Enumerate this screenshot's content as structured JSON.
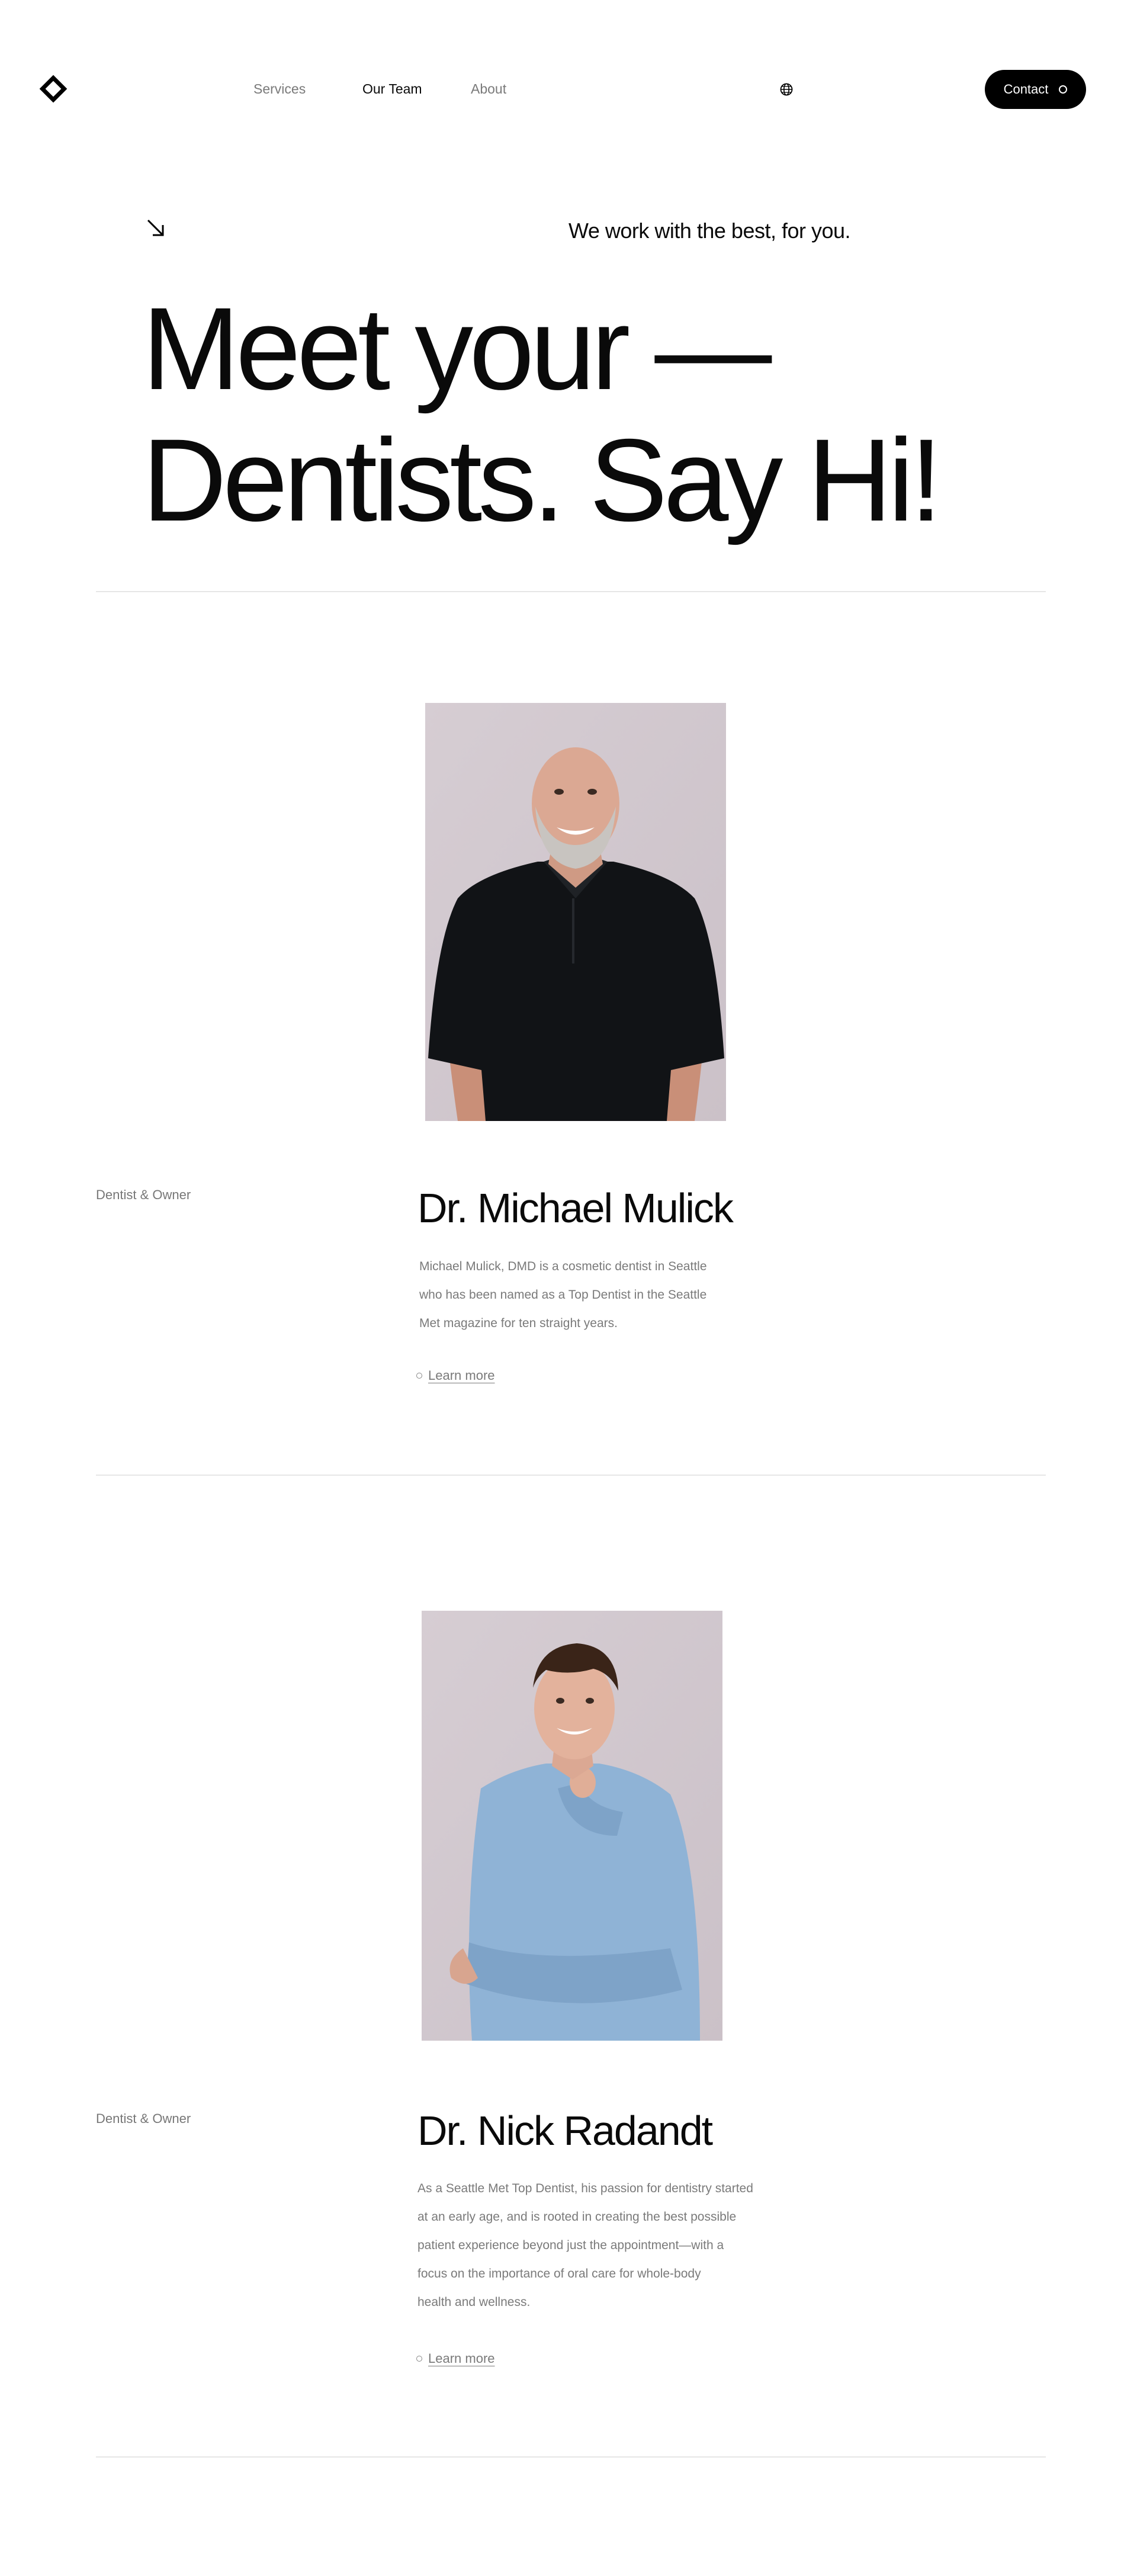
{
  "nav": {
    "links": [
      {
        "label": "Services"
      },
      {
        "label": "Our Team"
      },
      {
        "label": "About"
      }
    ],
    "contact_label": "Contact"
  },
  "hero": {
    "tagline": "We work with the best, for you.",
    "headline_line1": "Meet your —",
    "headline_line2": "Dentists. Say Hi!"
  },
  "dentists": [
    {
      "role": "Dentist & Owner",
      "name": "Dr. Michael Mulick",
      "bio_lines": [
        "Michael Mulick, DMD is a cosmetic dentist in Seattle",
        "who has been named as a Top Dentist in the Seattle",
        "Met magazine for ten straight years."
      ],
      "cta": "Learn more",
      "shirt_color": "#111316"
    },
    {
      "role": "Dentist & Owner",
      "name": "Dr. Nick Radandt",
      "bio_lines": [
        "As a Seattle Met Top Dentist, his passion for dentistry started",
        "at an early age, and is rooted in creating the best possible",
        "patient experience beyond just the appointment—with a",
        "focus on the importance of oral care for whole-body",
        "health and wellness."
      ],
      "cta": "Learn more",
      "shirt_color": "#8fb3d6"
    }
  ],
  "colors": {
    "text": "#0a0a0a",
    "muted": "#7a7a7a",
    "divider": "#e6e6e6",
    "photo_bg": "#d9d1d6",
    "button_bg": "#000000"
  },
  "icons": [
    "logo-diamond-icon",
    "globe-icon",
    "arrow-down-right-icon",
    "circle-icon"
  ]
}
